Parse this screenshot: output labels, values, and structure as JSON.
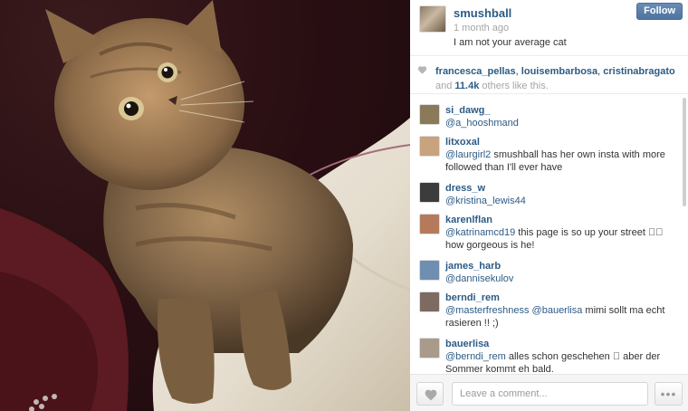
{
  "post": {
    "username": "smushball",
    "time": "1 month ago",
    "caption": "I am not your average cat",
    "follow_label": "Follow",
    "photo_icon": "cat-photo"
  },
  "likes": {
    "users": [
      "francesca_pellas",
      "louisembarbosa",
      "cristinabragato"
    ],
    "sep": ", ",
    "and": "and",
    "count": "11.4k",
    "suffix": "others like this."
  },
  "comments": [
    {
      "user": "si_dawg_",
      "mention": "@a_hooshmand",
      "text": "",
      "avatar_color": "#8a7a5a"
    },
    {
      "user": "litxoxal",
      "mention": "@laurgirl2",
      "text": " smushball has her own insta with more followed than I'll ever have",
      "avatar_color": "#c9a27e"
    },
    {
      "user": "dress_w",
      "mention": "@kristina_lewis44",
      "text": "",
      "avatar_color": "#3c3c3c"
    },
    {
      "user": "karenlflan",
      "mention": "@katrinamcd19",
      "text": " this page is so up your street 􀀀􀀀 how gorgeous is he!",
      "avatar_color": "#b57a5c"
    },
    {
      "user": "james_harb",
      "mention": "@dannisekulov",
      "text": "",
      "avatar_color": "#6f8fb0"
    },
    {
      "user": "berndi_rem",
      "mention": "@masterfreshness",
      "mention2": "@bauerlisa",
      "text": " mimi sollt ma echt rasieren !! ;)",
      "avatar_color": "#7d6a60"
    },
    {
      "user": "bauerlisa",
      "mention": "@berndi_rem",
      "text": " alles schon geschehen 􀀀 aber der Sommer kommt eh bald.",
      "avatar_color": "#a99a8a"
    }
  ],
  "footer": {
    "comment_placeholder": "Leave a comment...",
    "more_label": "•••"
  },
  "colors": {
    "link": "#2c5b86",
    "muted": "#a5a5a5",
    "follow_bg": "#5a80ab"
  }
}
